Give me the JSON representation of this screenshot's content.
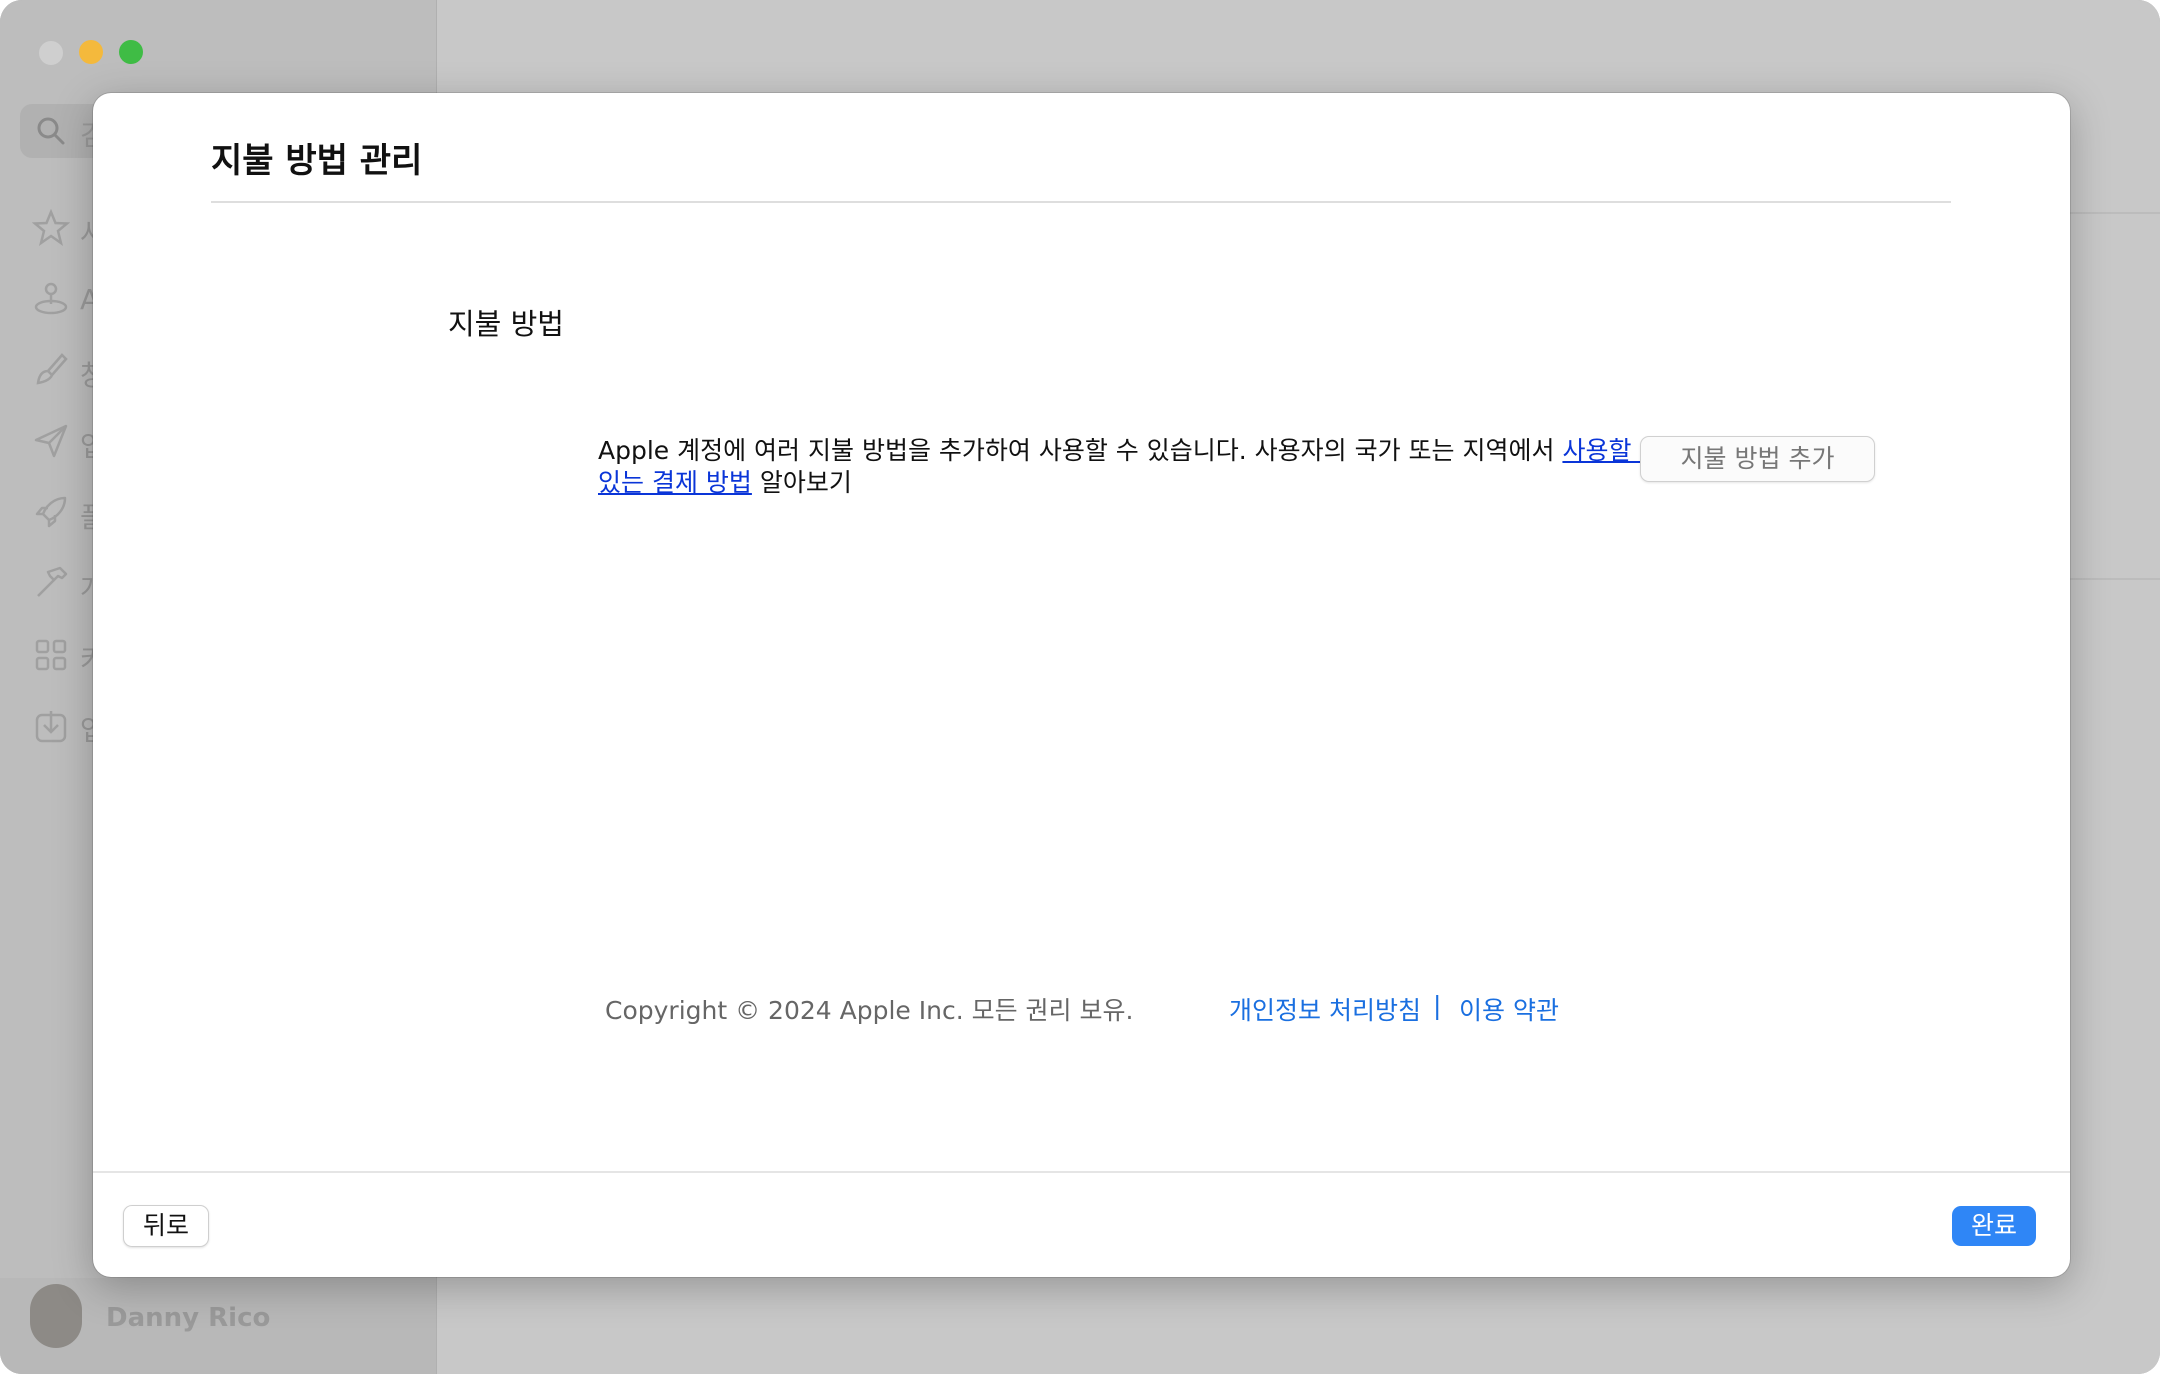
{
  "sidebar": {
    "search_placeholder": "검",
    "items": [
      {
        "icon": "star-icon",
        "label": "사"
      },
      {
        "icon": "arcade-icon",
        "label": "A"
      },
      {
        "icon": "brush-icon",
        "label": "창"
      },
      {
        "icon": "paper-plane-icon",
        "label": "업"
      },
      {
        "icon": "rocket-icon",
        "label": "플"
      },
      {
        "icon": "hammer-icon",
        "label": "개"
      },
      {
        "icon": "grid-icon",
        "label": "카"
      },
      {
        "icon": "download-icon",
        "label": "업"
      }
    ],
    "user_name": "Danny Rico"
  },
  "dialog": {
    "title": "지불 방법 관리",
    "section_heading": "지불 방법",
    "description": "Apple 계정에 여러 지불 방법을 추가하여 사용할 수 있습니다. 사용자의 국가 또는 지역에서 ",
    "description_link": "사용할 수 있는 결제 방법",
    "description_suffix": " 알아보기",
    "add_button": "지불 방법 추가",
    "copyright": "Copyright © 2024 Apple Inc. 모든 권리 보유.",
    "privacy_link": "개인정보 처리방침",
    "separator": "|",
    "terms_link": "이용 약관",
    "back_button": "뒤로",
    "done_button": "완료"
  },
  "colors": {
    "accent": "#2f86f6",
    "link": "#0a35d8",
    "footer_link": "#1a6fe0"
  }
}
